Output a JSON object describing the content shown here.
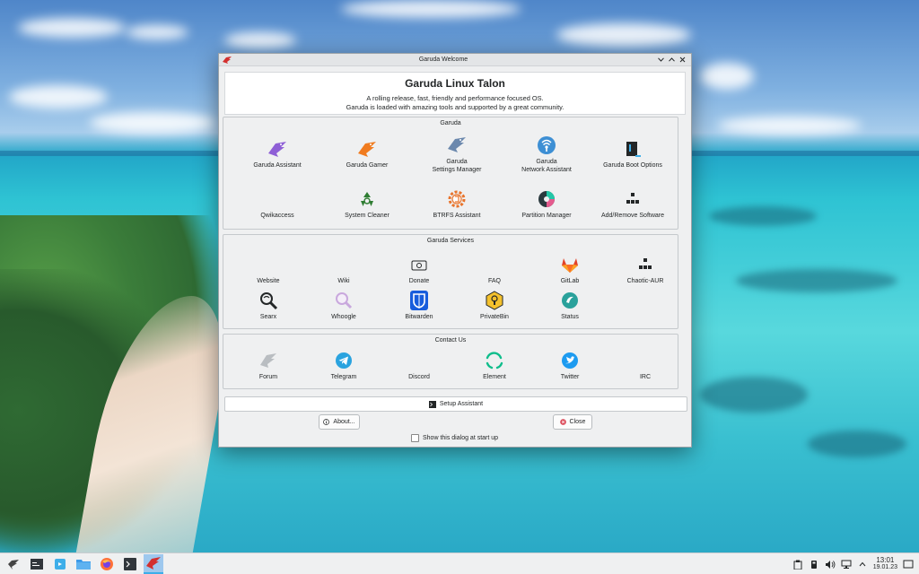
{
  "window": {
    "title": "Garuda Welcome",
    "heading": "Garuda Linux Talon",
    "subtitle1": "A rolling release, fast, friendly and performance focused OS.",
    "subtitle2": "Garuda is loaded with amazing tools and supported by a great community."
  },
  "groups": {
    "garuda": {
      "title": "Garuda",
      "items": [
        {
          "label": "Garuda Assistant"
        },
        {
          "label": "Garuda Gamer"
        },
        {
          "label": "Garuda\nSettings Manager"
        },
        {
          "label": "Garuda\nNetwork Assistant"
        },
        {
          "label": "Garuda Boot Options"
        },
        {
          "label": "Qwikaccess"
        },
        {
          "label": "System Cleaner"
        },
        {
          "label": "BTRFS Assistant"
        },
        {
          "label": "Partition Manager"
        },
        {
          "label": "Add/Remove Software"
        }
      ]
    },
    "services": {
      "title": "Garuda Services",
      "items": [
        {
          "label": "Website"
        },
        {
          "label": "Wiki"
        },
        {
          "label": "Donate"
        },
        {
          "label": "FAQ"
        },
        {
          "label": "GitLab"
        },
        {
          "label": "Chaotic-AUR"
        },
        {
          "label": "Searx"
        },
        {
          "label": "Whoogle"
        },
        {
          "label": "Bitwarden"
        },
        {
          "label": "PrivateBin"
        },
        {
          "label": "Status"
        }
      ]
    },
    "contact": {
      "title": "Contact Us",
      "items": [
        {
          "label": "Forum"
        },
        {
          "label": "Telegram"
        },
        {
          "label": "Discord"
        },
        {
          "label": "Element"
        },
        {
          "label": "Twitter"
        },
        {
          "label": "IRC"
        }
      ]
    }
  },
  "buttons": {
    "setup": "Setup Assistant",
    "about": "About...",
    "close": "Close",
    "startup_checkbox": "Show this dialog at start up"
  },
  "taskbar": {
    "time": "13:01",
    "date": "19.01.23"
  },
  "colors": {
    "accent": "#3daee9",
    "window_bg": "#eff0f1",
    "garuda_purple": "#8e5fd6",
    "garuda_orange": "#f07b1f"
  }
}
